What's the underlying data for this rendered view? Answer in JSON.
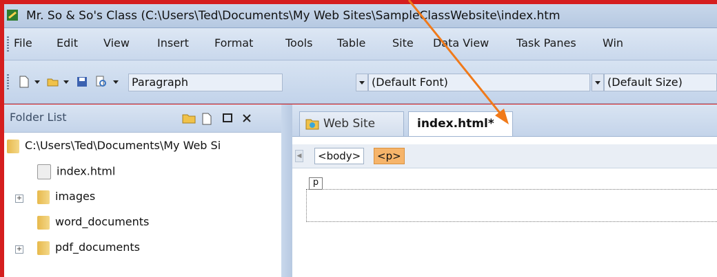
{
  "window": {
    "title": "Mr. So & So's Class (C:\\Users\\Ted\\Documents\\My Web Sites\\SampleClassWebsite\\index.htm"
  },
  "menu": {
    "items": [
      {
        "label": "File"
      },
      {
        "label": "Edit"
      },
      {
        "label": "View"
      },
      {
        "label": "Insert"
      },
      {
        "label": "Format"
      },
      {
        "label": "Tools"
      },
      {
        "label": "Table"
      },
      {
        "label": "Site"
      },
      {
        "label": "Data View"
      },
      {
        "label": "Task Panes"
      },
      {
        "label": "Win"
      }
    ]
  },
  "toolbar": {
    "style_value": "Paragraph",
    "font_value": "(Default Font)",
    "size_value": "(Default Size)"
  },
  "folder_list": {
    "title": "Folder List",
    "root": "C:\\Users\\Ted\\Documents\\My Web Si",
    "items": [
      {
        "label": "index.html",
        "icon": "html-file-icon"
      },
      {
        "label": "images",
        "icon": "folder-icon",
        "expandable": true
      },
      {
        "label": "word_documents",
        "icon": "folder-icon"
      },
      {
        "label": "pdf_documents",
        "icon": "folder-icon",
        "expandable": true
      }
    ]
  },
  "editor": {
    "tabs": [
      {
        "label": "Web Site"
      },
      {
        "label": "index.html*"
      }
    ],
    "tags": [
      "<body>",
      "<p>"
    ],
    "block_label": "p"
  },
  "colors": {
    "frame": "#d51e1e",
    "arrow": "#f07a1a",
    "selected_tag": "#f6b46a"
  }
}
